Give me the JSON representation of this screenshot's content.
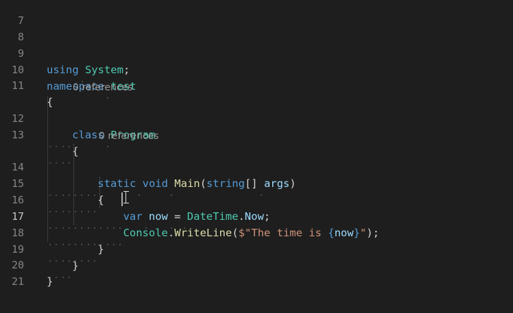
{
  "editor": {
    "language": "csharp",
    "current_line": "17",
    "lines": [
      {
        "num": "7"
      },
      {
        "num": "8"
      },
      {
        "num": "9"
      },
      {
        "num": "10"
      },
      {
        "num": "11"
      },
      {
        "num": "12"
      },
      {
        "num": "13"
      },
      {
        "num": "14"
      },
      {
        "num": "15"
      },
      {
        "num": "16"
      },
      {
        "num": "17"
      },
      {
        "num": "18"
      },
      {
        "num": "19"
      },
      {
        "num": "20"
      },
      {
        "num": "21"
      }
    ],
    "codelens": {
      "class_refs": "0 references",
      "method_refs": "0 references"
    },
    "tokens": {
      "using": "using",
      "system": "System",
      "semicolon": ";",
      "namespace": "namespace",
      "ns_name": "test",
      "open_brace": "{",
      "close_brace": "}",
      "class": "class",
      "class_name": "Program",
      "static": "static",
      "void": "void",
      "main": "Main",
      "lparen": "(",
      "string": "string",
      "brackets": "[]",
      "args": "args",
      "rparen": ")",
      "var": "var",
      "now": "now",
      "equals": "=",
      "datetime": "DateTime",
      "dot": ".",
      "now_prop": "Now",
      "console": "Console",
      "writeline": "WriteLine",
      "interp_open": "$\"The time is ",
      "interp_lbrace": "{",
      "interp_var": "now",
      "interp_rbrace": "}",
      "interp_close": "\"",
      "stmt_end": ");"
    }
  },
  "colors": {
    "background": "#1e1e1e",
    "keyword": "#569cd6",
    "type": "#4ec9b0",
    "function": "#dcdcaa",
    "variable": "#9cdcfe",
    "string": "#ce9178",
    "line_number": "#858585",
    "codelens": "#999999"
  }
}
